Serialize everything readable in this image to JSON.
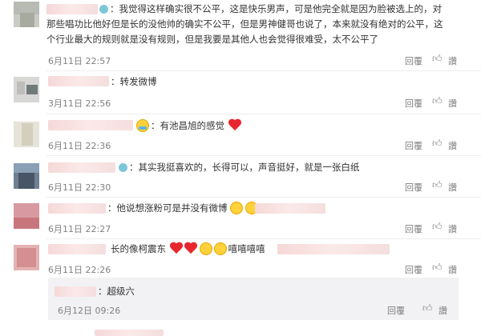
{
  "actions": {
    "reply": "回覆",
    "like": "讚"
  },
  "comments": [
    {
      "text": "：我觉得这样确实很不公平，这是快乐男声，可是他完全就是因为脸被选上的，对",
      "text2": "那些唱功比他好但是长的没他帅的确实不公平，但是男神健哥也说了，本来就没有绝对的公平，这",
      "text3": "个行业最大的规则就是没有规则，但是我要是其他人也会觉得很难受，太不公平了",
      "time": "6月11日 22:57"
    },
    {
      "text": "：转发微博",
      "time": "3月11日 22:56"
    },
    {
      "text": "：有池昌旭的感觉",
      "time": "6月11日 22:36"
    },
    {
      "text": "：其实我挺喜欢的，长得可以，声音挺好，就是一张白纸",
      "time": "6月11日 22:30"
    },
    {
      "text": "：他说想涨粉可是并没有微博",
      "time": "6月11日 22:27"
    },
    {
      "text": "长的像柯震东",
      "text2": "嘻嘻嘻嘻",
      "time": "6月11日 22:26"
    }
  ],
  "nested": {
    "text": "：超级六",
    "time": "6月12日 09:26"
  },
  "icons": {
    "thumb": "thumb-up-icon",
    "heart": "heart-icon",
    "emoji": "emoji-face-icon",
    "badge": "vip-badge-icon"
  },
  "colors": {
    "name": "#eb7350",
    "meta": "#808080",
    "heart": "#e8262e"
  }
}
